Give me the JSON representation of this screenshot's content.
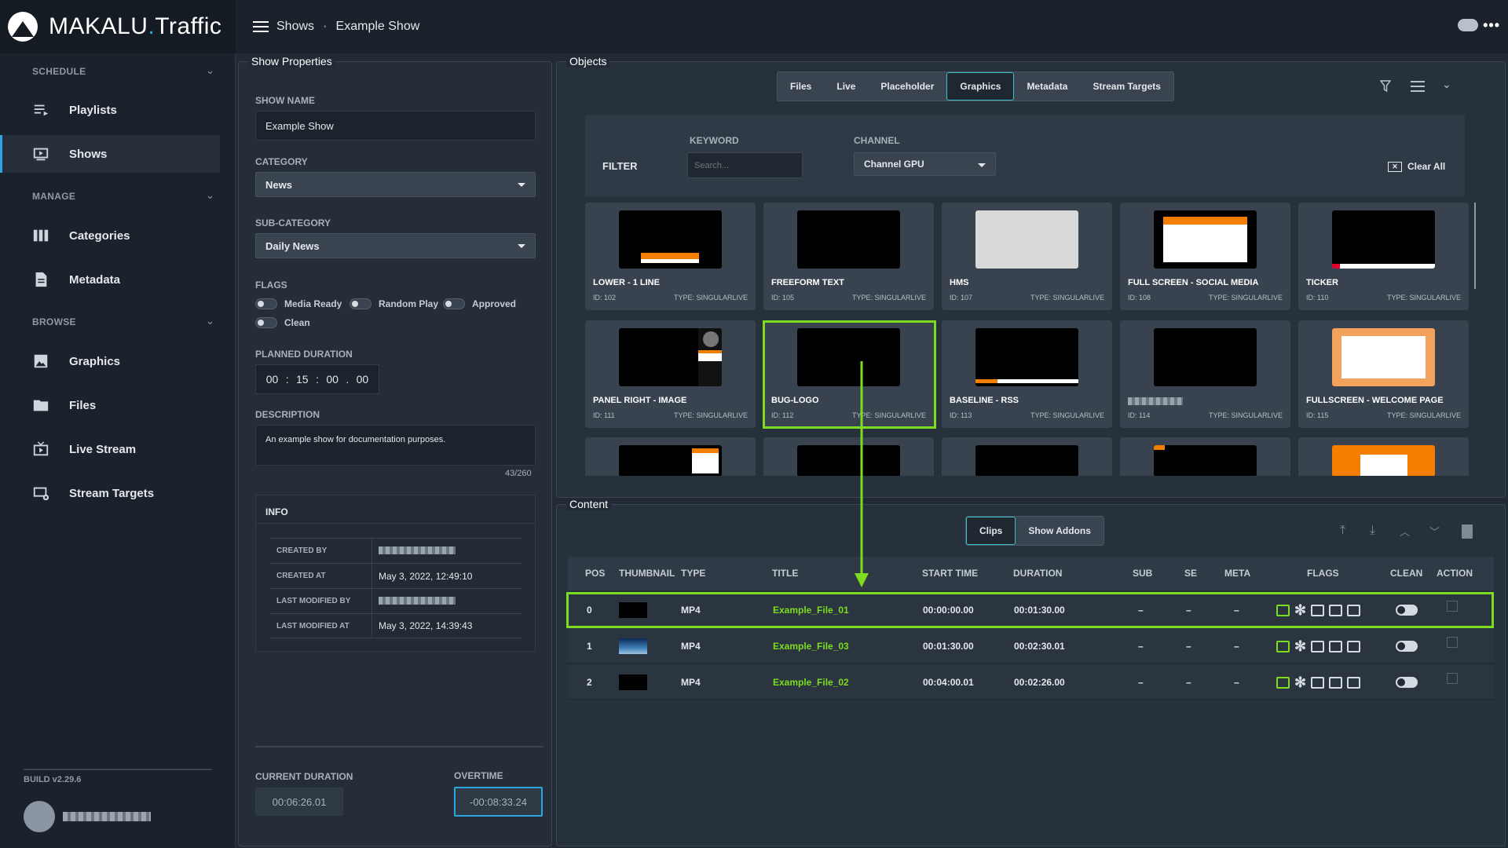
{
  "brand": {
    "name": "MAKALU",
    "dot": ".",
    "suffix": "Traffic"
  },
  "breadcrumb": {
    "root": "Shows",
    "sep": "•",
    "current": "Example Show"
  },
  "sidebar": {
    "sections": [
      {
        "label": "SCHEDULE"
      },
      {
        "label": "MANAGE"
      },
      {
        "label": "BROWSE"
      }
    ],
    "items": [
      {
        "label": "Playlists"
      },
      {
        "label": "Shows"
      },
      {
        "label": "Categories"
      },
      {
        "label": "Metadata"
      },
      {
        "label": "Graphics"
      },
      {
        "label": "Files"
      },
      {
        "label": "Live Stream"
      },
      {
        "label": "Stream Targets"
      }
    ],
    "build": "BUILD v2.29.6"
  },
  "props": {
    "title": "Show Properties",
    "show_name_label": "SHOW NAME",
    "show_name": "Example Show",
    "category_label": "CATEGORY",
    "category": "News",
    "subcategory_label": "SUB-CATEGORY",
    "subcategory": "Daily News",
    "flags_label": "FLAGS",
    "flags": [
      {
        "label": "Media Ready",
        "on": false
      },
      {
        "label": "Random Play",
        "on": false
      },
      {
        "label": "Approved",
        "on": false
      },
      {
        "label": "Clean",
        "on": false
      }
    ],
    "planned_label": "PLANNED DURATION",
    "planned": [
      "00",
      "15",
      "00",
      "00"
    ],
    "planned_sep": [
      ":",
      ":",
      "."
    ],
    "description_label": "DESCRIPTION",
    "description": "An example show for documentation purposes.",
    "desc_count": "43/260",
    "info_title": "INFO",
    "info": [
      {
        "k": "CREATED BY",
        "v": ""
      },
      {
        "k": "CREATED AT",
        "v": "May 3, 2022, 12:49:10"
      },
      {
        "k": "LAST MODIFIED BY",
        "v": ""
      },
      {
        "k": "LAST MODIFIED AT",
        "v": "May 3, 2022, 14:39:43"
      }
    ],
    "current_label": "CURRENT DURATION",
    "current": "00:06:26.01",
    "overtime_label": "OVERTIME",
    "overtime": "-00:08:33.24"
  },
  "objects": {
    "title": "Objects",
    "tabs": [
      {
        "label": "Files"
      },
      {
        "label": "Live"
      },
      {
        "label": "Placeholder"
      },
      {
        "label": "Graphics"
      },
      {
        "label": "Metadata"
      },
      {
        "label": "Stream Targets"
      }
    ],
    "active_tab": "Graphics",
    "filter_label": "FILTER",
    "keyword_label": "KEYWORD",
    "keyword_placeholder": "Search...",
    "channel_label": "CHANNEL",
    "channel": "Channel GPU",
    "clear_all": "Clear All",
    "cards": [
      {
        "name": "LOWER - 1 LINE",
        "id": "ID: 102",
        "type": "TYPE: SINGULARLIVE",
        "thumb": "lower"
      },
      {
        "name": "FREEFORM TEXT",
        "id": "ID: 105",
        "type": "TYPE: SINGULARLIVE",
        "thumb": "black"
      },
      {
        "name": "HMS",
        "id": "ID: 107",
        "type": "TYPE: SINGULARLIVE",
        "thumb": "grey"
      },
      {
        "name": "FULL SCREEN - SOCIAL MEDIA",
        "id": "ID: 108",
        "type": "TYPE: SINGULARLIVE",
        "thumb": "social"
      },
      {
        "name": "TICKER",
        "id": "ID: 110",
        "type": "TYPE: SINGULARLIVE",
        "thumb": "ticker"
      },
      {
        "name": "PANEL RIGHT - IMAGE",
        "id": "ID: 111",
        "type": "TYPE: SINGULARLIVE",
        "thumb": "panel"
      },
      {
        "name": "BUG-LOGO",
        "id": "ID: 112",
        "type": "TYPE: SINGULARLIVE",
        "thumb": "black"
      },
      {
        "name": "BASELINE - RSS",
        "id": "ID: 113",
        "type": "TYPE: SINGULARLIVE",
        "thumb": "baseline"
      },
      {
        "name": "",
        "id": "ID: 114",
        "type": "TYPE: SINGULARLIVE",
        "thumb": "black"
      },
      {
        "name": "FULLSCREEN - WELCOME PAGE",
        "id": "ID: 115",
        "type": "TYPE: SINGULARLIVE",
        "thumb": "welcome"
      }
    ]
  },
  "content": {
    "title": "Content",
    "tabs": [
      {
        "label": "Clips"
      },
      {
        "label": "Show Addons"
      }
    ],
    "headers": [
      "POS",
      "THUMBNAIL",
      "TYPE",
      "TITLE",
      "START TIME",
      "DURATION",
      "SUB",
      "SE",
      "META",
      "FLAGS",
      "CLEAN",
      "ACTION"
    ],
    "rows": [
      {
        "pos": "0",
        "type": "MP4",
        "title": "Example_File_01",
        "start": "00:00:00.00",
        "duration": "00:01:30.00",
        "sub": "–",
        "se": "–",
        "meta": "–",
        "thumb": "black"
      },
      {
        "pos": "1",
        "type": "MP4",
        "title": "Example_File_03",
        "start": "00:01:30.00",
        "duration": "00:02:30.01",
        "sub": "–",
        "se": "–",
        "meta": "–",
        "thumb": "sky"
      },
      {
        "pos": "2",
        "type": "MP4",
        "title": "Example_File_02",
        "start": "00:04:00.01",
        "duration": "00:02:26.00",
        "sub": "–",
        "se": "–",
        "meta": "–",
        "thumb": "black"
      }
    ]
  },
  "colors": {
    "accent": "#2aa7e0",
    "highlight": "#7ddc1f",
    "teal": "#3ec0c9"
  }
}
